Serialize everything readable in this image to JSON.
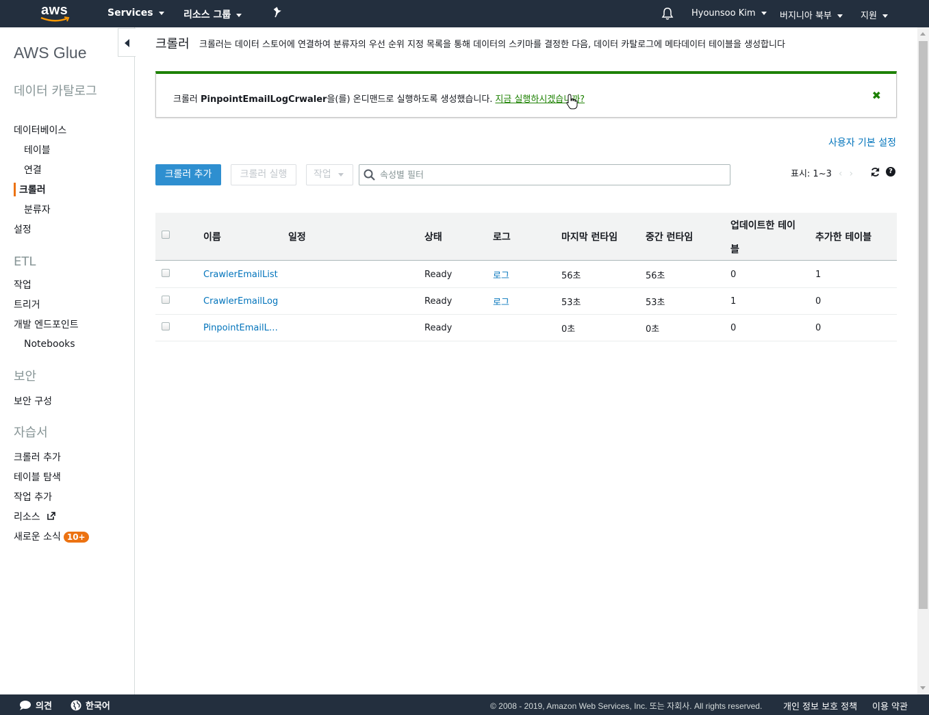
{
  "topnav": {
    "logo": "aws",
    "services": "Services",
    "resource_groups": "리소스 그룹",
    "pin_icon": "pin-icon",
    "bell_icon": "bell-icon",
    "user": "Hyounsoo Kim",
    "region": "버지니아 북부",
    "support": "지원"
  },
  "sidebar": {
    "title": "AWS Glue",
    "catalog_head": "데이터 카탈로그",
    "databases": "데이터베이스",
    "tables": "테이블",
    "connections": "연결",
    "crawlers": "크롤러",
    "classifiers": "분류자",
    "settings": "설정",
    "etl_head": "ETL",
    "jobs": "작업",
    "triggers": "트리거",
    "dev_endpoints": "개발 엔드포인트",
    "notebooks": "Notebooks",
    "security_head": "보안",
    "security_config": "보안 구성",
    "tutorials_head": "자습서",
    "add_crawler": "크롤러 추가",
    "explore_table": "테이블 탐색",
    "add_job": "작업 추가",
    "resources": "리소스",
    "whats_new": "새로운 소식",
    "whats_new_badge": "10+"
  },
  "page": {
    "title": "크롤러",
    "description": "크롤러는 데이터 스토어에 연결하여 분류자의 우선 순위 지정 목록을 통해 데이터의 스키마를 결정한 다음, 데이터 카탈로그에 메타데이터 테이블을 생성합니다"
  },
  "flash": {
    "prefix": "크롤러 ",
    "crawler_name": "PinpointEmailLogCrwaler",
    "suffix": "을(를) 온디맨드로 실행하도록 생성했습니다.",
    "link": "지금 실행하시겠습니까?",
    "color": "#1d8102"
  },
  "toolbar": {
    "user_prefs": "사용자 기본 설정",
    "add_crawler": "크롤러 추가",
    "run_crawler": "크롤러 실행",
    "action": "작업",
    "filter_placeholder": "속성별 필터",
    "pager": "표시: 1~3"
  },
  "table": {
    "headers": {
      "name": "이름",
      "schedule": "일정",
      "status": "상태",
      "logs": "로그",
      "last_runtime": "마지막 런타임",
      "median_runtime": "중간 런타임",
      "tables_updated_1": "업데이트한 테이",
      "tables_updated_2": "블",
      "tables_added": "추가한 테이블"
    },
    "rows": [
      {
        "name": "CrawlerEmailList",
        "schedule": "",
        "status": "Ready",
        "logs": "로그",
        "last": "56초",
        "median": "56초",
        "updated": "0",
        "added": "1"
      },
      {
        "name": "CrawlerEmailLog",
        "schedule": "",
        "status": "Ready",
        "logs": "로그",
        "last": "53초",
        "median": "53초",
        "updated": "1",
        "added": "0"
      },
      {
        "name": "PinpointEmailL…",
        "schedule": "",
        "status": "Ready",
        "logs": "",
        "last": "0초",
        "median": "0초",
        "updated": "0",
        "added": "0"
      }
    ]
  },
  "footer": {
    "feedback": "의견",
    "language": "한국어",
    "copyright": "© 2008 - 2019, Amazon Web Services, Inc. 또는 자회사. All rights reserved.",
    "privacy": "개인 정보 보호 정책",
    "terms": "이용 약관"
  },
  "colors": {
    "nav_bg": "#232f3e",
    "accent": "#ec7211",
    "link": "#0073bb",
    "primary_button": "#2e8fd0"
  }
}
